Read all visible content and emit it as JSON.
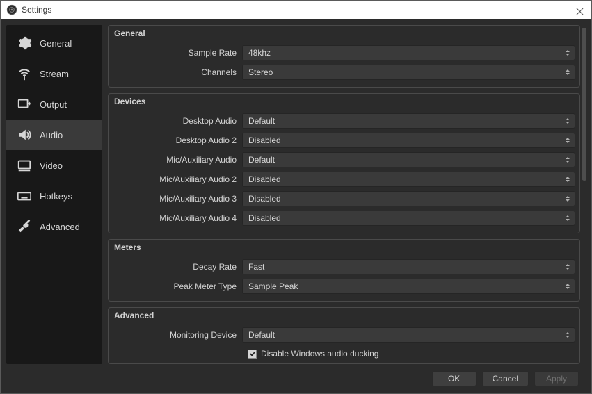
{
  "window": {
    "title": "Settings"
  },
  "sidebar": {
    "items": [
      {
        "label": "General"
      },
      {
        "label": "Stream"
      },
      {
        "label": "Output"
      },
      {
        "label": "Audio"
      },
      {
        "label": "Video"
      },
      {
        "label": "Hotkeys"
      },
      {
        "label": "Advanced"
      }
    ]
  },
  "groups": {
    "general": {
      "title": "General",
      "sample_rate": {
        "label": "Sample Rate",
        "value": "48khz"
      },
      "channels": {
        "label": "Channels",
        "value": "Stereo"
      }
    },
    "devices": {
      "title": "Devices",
      "desktop_audio": {
        "label": "Desktop Audio",
        "value": "Default"
      },
      "desktop_audio_2": {
        "label": "Desktop Audio 2",
        "value": "Disabled"
      },
      "mic_aux": {
        "label": "Mic/Auxiliary Audio",
        "value": "Default"
      },
      "mic_aux_2": {
        "label": "Mic/Auxiliary Audio 2",
        "value": "Disabled"
      },
      "mic_aux_3": {
        "label": "Mic/Auxiliary Audio 3",
        "value": "Disabled"
      },
      "mic_aux_4": {
        "label": "Mic/Auxiliary Audio 4",
        "value": "Disabled"
      }
    },
    "meters": {
      "title": "Meters",
      "decay_rate": {
        "label": "Decay Rate",
        "value": "Fast"
      },
      "peak_meter_type": {
        "label": "Peak Meter Type",
        "value": "Sample Peak"
      }
    },
    "advanced": {
      "title": "Advanced",
      "monitoring_device": {
        "label": "Monitoring Device",
        "value": "Default"
      },
      "win_audio_ducking": {
        "label": "Disable Windows audio ducking",
        "checked": true
      }
    }
  },
  "footer": {
    "ok": "OK",
    "cancel": "Cancel",
    "apply": "Apply"
  }
}
